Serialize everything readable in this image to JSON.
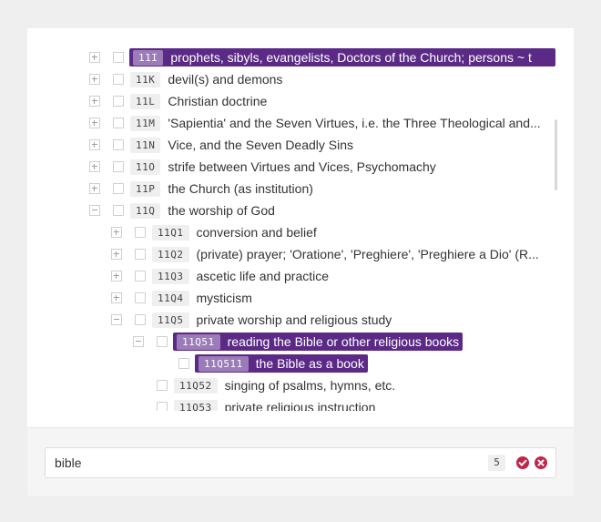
{
  "tree": {
    "rows": [
      {
        "code": "11I",
        "label": "prophets, sibyls, evangelists, Doctors of the Church; persons ~ t",
        "toggle": "plus",
        "highlighted": true
      },
      {
        "code": "11K",
        "label": "devil(s) and demons",
        "toggle": "plus",
        "highlighted": false
      },
      {
        "code": "11L",
        "label": "Christian doctrine",
        "toggle": "plus",
        "highlighted": false
      },
      {
        "code": "11M",
        "label": "'Sapientia' and the Seven Virtues, i.e. the Three Theological and...",
        "toggle": "plus",
        "highlighted": false
      },
      {
        "code": "11N",
        "label": "Vice, and the Seven Deadly Sins",
        "toggle": "plus",
        "highlighted": false
      },
      {
        "code": "11O",
        "label": "strife between Virtues and Vices, Psychomachy",
        "toggle": "plus",
        "highlighted": false
      },
      {
        "code": "11P",
        "label": "the Church (as institution)",
        "toggle": "plus",
        "highlighted": false
      },
      {
        "code": "11Q",
        "label": "the worship of God",
        "toggle": "minus",
        "highlighted": false
      },
      {
        "code": "11Q1",
        "label": "conversion and belief",
        "toggle": "plus",
        "highlighted": false
      },
      {
        "code": "11Q2",
        "label": "(private) prayer; 'Oratione', 'Preghiere', 'Preghiere a Dio' (R...",
        "toggle": "plus",
        "highlighted": false
      },
      {
        "code": "11Q3",
        "label": "ascetic life and practice",
        "toggle": "plus",
        "highlighted": false
      },
      {
        "code": "11Q4",
        "label": "mysticism",
        "toggle": "plus",
        "highlighted": false
      },
      {
        "code": "11Q5",
        "label": "private worship and religious study",
        "toggle": "minus",
        "highlighted": false
      },
      {
        "code": "11Q51",
        "label": "reading the Bible or other religious books",
        "toggle": "minus",
        "highlighted": true
      },
      {
        "code": "11Q511",
        "label": "the Bible as a book",
        "toggle": "none",
        "highlighted": true
      },
      {
        "code": "11Q52",
        "label": "singing of psalms, hymns, etc.",
        "toggle": "none",
        "highlighted": false
      },
      {
        "code": "11Q53",
        "label": "private religious instruction",
        "toggle": "none",
        "highlighted": false
      }
    ]
  },
  "search": {
    "value": "bible",
    "result_count": "5",
    "confirm_icon": "check-circle-icon",
    "clear_icon": "close-circle-icon"
  },
  "colors": {
    "highlight": "#5b2a86",
    "highlight_code": "#9b7bb8",
    "icon_red": "#c0264a"
  }
}
